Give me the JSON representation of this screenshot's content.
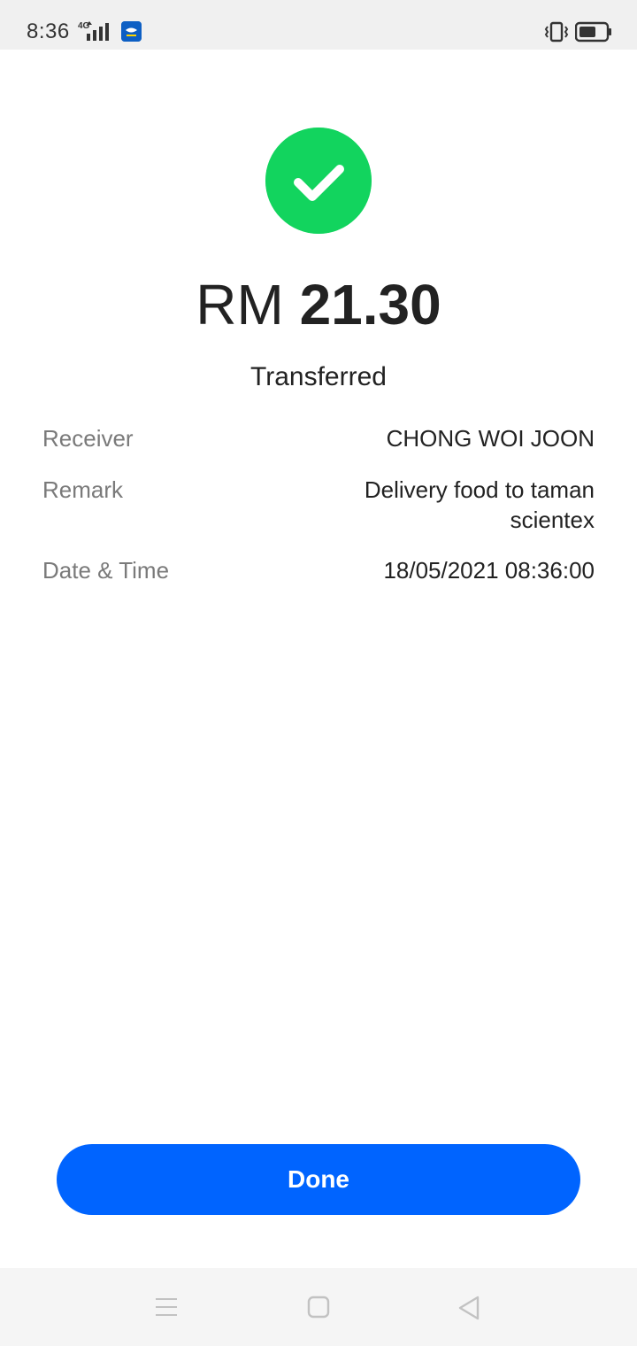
{
  "status_bar": {
    "time": "8:36",
    "network": "4G",
    "icons": [
      "signal-icon",
      "app-badge-icon",
      "vibrate-icon",
      "battery-icon"
    ]
  },
  "receipt": {
    "status_icon": "check-circle-icon",
    "currency": "RM",
    "amount": "21.30",
    "status": "Transferred",
    "details": {
      "receiver": {
        "label": "Receiver",
        "value": "CHONG WOI JOON"
      },
      "remark": {
        "label": "Remark",
        "value": "Delivery food to taman scientex"
      },
      "datetime": {
        "label": "Date & Time",
        "value": "18/05/2021 08:36:00"
      }
    }
  },
  "actions": {
    "done_label": "Done"
  },
  "nav_bar": {
    "icons": [
      "menu-icon",
      "home-icon",
      "back-icon"
    ]
  },
  "colors": {
    "success": "#12d45e",
    "primary_button": "#0064ff",
    "text_primary": "#222222",
    "text_secondary": "#7a7a7a"
  }
}
